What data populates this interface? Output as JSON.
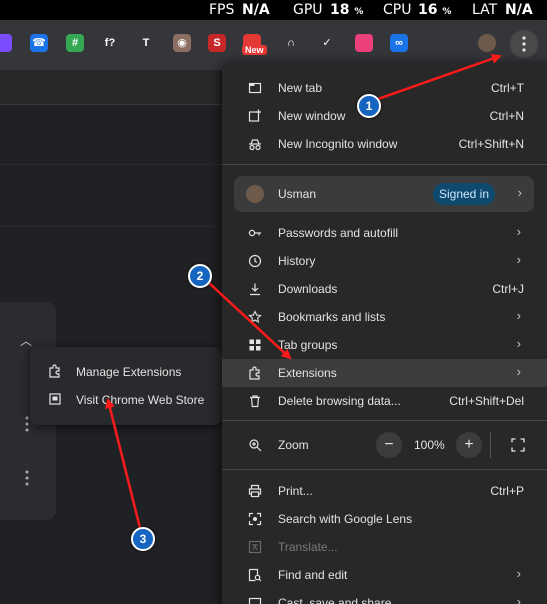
{
  "perf_overlay": {
    "fps_label": "FPS",
    "fps_value": "N/A",
    "gpu_label": "GPU",
    "gpu_value": "18",
    "gpu_unit": "%",
    "cpu_label": "CPU",
    "cpu_value": "16",
    "cpu_unit": "%",
    "lat_label": "LAT",
    "lat_value": "N/A"
  },
  "toolbar": {
    "extensions": [
      {
        "icon": "puzzle-purple-icon",
        "color": "#7c4dff",
        "glyph": ""
      },
      {
        "icon": "phone-icon",
        "color": "#1a73e8",
        "glyph": "☎"
      },
      {
        "icon": "hash-icon",
        "color": "#34a853",
        "glyph": "#"
      },
      {
        "icon": "fx-icon",
        "color": "#35363a",
        "glyph": "f?"
      },
      {
        "icon": "text-t-icon",
        "color": "#35363a",
        "glyph": "T"
      },
      {
        "icon": "owl-icon",
        "color": "#8d6e63",
        "glyph": "◉"
      },
      {
        "icon": "seo-icon",
        "color": "#c62828",
        "glyph": "S"
      },
      {
        "icon": "new-badge-icon",
        "color": "#e53935",
        "glyph": ""
      },
      {
        "icon": "arch-icon",
        "color": "#35363a",
        "glyph": "∩"
      },
      {
        "icon": "v-check-icon",
        "color": "#35363a",
        "glyph": "✓"
      },
      {
        "icon": "square-pink-icon",
        "color": "#ec407a",
        "glyph": ""
      },
      {
        "icon": "infinity-icon",
        "color": "#1a73e8",
        "glyph": "∞"
      },
      {
        "icon": "extensions-puzzle-icon",
        "color": "#35363a",
        "glyph": ""
      }
    ],
    "new_badge": "New"
  },
  "menu": {
    "new_tab": {
      "label": "New tab",
      "shortcut": "Ctrl+T"
    },
    "new_window": {
      "label": "New window",
      "shortcut": "Ctrl+N"
    },
    "new_incognito": {
      "label": "New Incognito window",
      "shortcut": "Ctrl+Shift+N"
    },
    "profile": {
      "name": "Usman",
      "status": "Signed in"
    },
    "passwords": {
      "label": "Passwords and autofill"
    },
    "history": {
      "label": "History"
    },
    "downloads": {
      "label": "Downloads",
      "shortcut": "Ctrl+J"
    },
    "bookmarks": {
      "label": "Bookmarks and lists"
    },
    "tab_groups": {
      "label": "Tab groups"
    },
    "extensions": {
      "label": "Extensions"
    },
    "delete_data": {
      "label": "Delete browsing data...",
      "shortcut": "Ctrl+Shift+Del"
    },
    "zoom": {
      "label": "Zoom",
      "minus": "−",
      "value": "100%",
      "plus": "+"
    },
    "print": {
      "label": "Print...",
      "shortcut": "Ctrl+P"
    },
    "lens": {
      "label": "Search with Google Lens"
    },
    "translate": {
      "label": "Translate..."
    },
    "find_edit": {
      "label": "Find and edit"
    },
    "cast": {
      "label": "Cast, save and share"
    }
  },
  "submenu": {
    "manage": "Manage Extensions",
    "web_store": "Visit Chrome Web Store"
  },
  "annotations": {
    "marker_1": "1",
    "marker_2": "2",
    "marker_3": "3",
    "color": "#ff1a1a"
  }
}
